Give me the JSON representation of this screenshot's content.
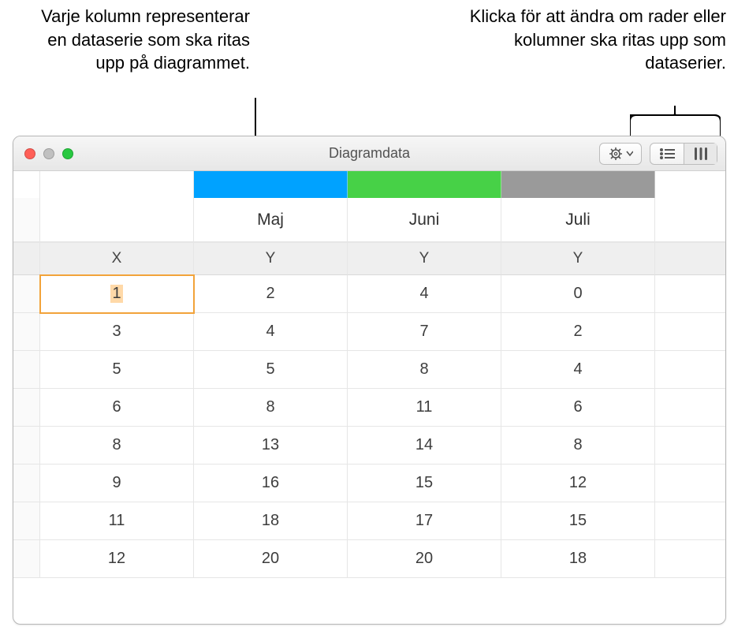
{
  "callouts": {
    "left": "Varje kolumn representerar en dataserie som ska ritas upp på diagrammet.",
    "right": "Klicka för att ändra om rader eller kolumner ska ritas upp som dataserier."
  },
  "window": {
    "title": "Diagramdata"
  },
  "series": {
    "colors": [
      "#00a2ff",
      "#47d147",
      "#9a9a9a"
    ],
    "months": [
      "Maj",
      "Juni",
      "Juli"
    ],
    "axis_x": "X",
    "axis_y": "Y"
  },
  "chart_data": {
    "type": "table",
    "x": [
      1,
      3,
      5,
      6,
      8,
      9,
      11,
      12
    ],
    "series": [
      {
        "name": "Maj",
        "values": [
          2,
          4,
          5,
          8,
          13,
          16,
          18,
          20
        ]
      },
      {
        "name": "Juni",
        "values": [
          4,
          7,
          8,
          11,
          14,
          15,
          17,
          20
        ]
      },
      {
        "name": "Juli",
        "values": [
          0,
          2,
          4,
          6,
          8,
          12,
          15,
          18
        ]
      }
    ]
  }
}
